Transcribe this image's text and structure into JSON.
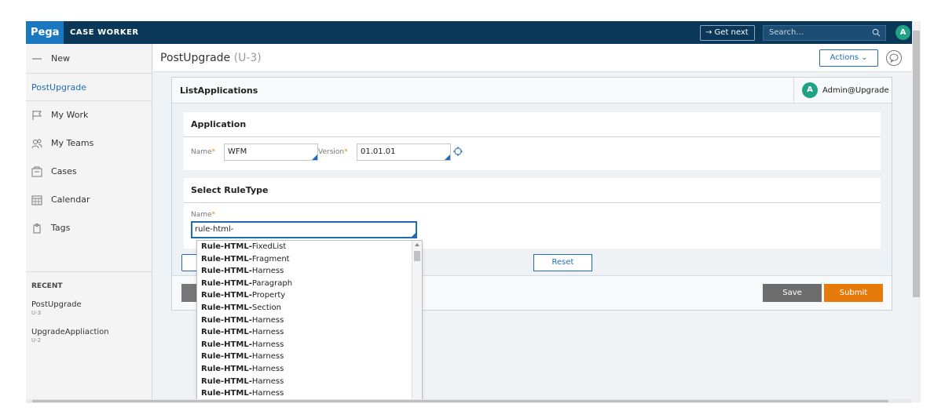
{
  "app": {
    "logo": "Pega",
    "portal_name": "CASE WORKER"
  },
  "topbar": {
    "get_next": "→ Get next",
    "search_placeholder": "Search...",
    "avatar_initial": "A"
  },
  "sidebar": {
    "new_label": "New",
    "current_case": "PostUpgrade",
    "items": [
      {
        "label": "My Work",
        "icon": "flag-icon"
      },
      {
        "label": "My Teams",
        "icon": "team-icon"
      },
      {
        "label": "Cases",
        "icon": "case-icon"
      },
      {
        "label": "Calendar",
        "icon": "calendar-icon"
      },
      {
        "label": "Tags",
        "icon": "tag-icon"
      }
    ],
    "recent_heading": "RECENT",
    "recent": [
      {
        "title": "PostUpgrade",
        "id": "U-3"
      },
      {
        "title": "UpgradeAppliaction",
        "id": "U-2"
      }
    ]
  },
  "case": {
    "title": "PostUpgrade",
    "id": "(U-3)",
    "actions_label": "Actions"
  },
  "panel": {
    "title": "ListApplications",
    "user": {
      "initial": "A",
      "name": "Admin@Upgrade"
    },
    "application": {
      "heading": "Application",
      "name_label": "Name",
      "name_value": "WFM",
      "version_label": "Version",
      "version_value": "01.01.01"
    },
    "ruletype": {
      "heading": "Select RuleType",
      "name_label": "Name",
      "name_value": "rule-html-"
    },
    "reset_label": "Reset",
    "save_label": "Save",
    "submit_label": "Submit",
    "required_mark": "*"
  },
  "dropdown": {
    "items": [
      {
        "match": "Rule-HTML-",
        "rest": "FixedList"
      },
      {
        "match": "Rule-HTML-",
        "rest": "Fragment"
      },
      {
        "match": "Rule-HTML-",
        "rest": "Harness"
      },
      {
        "match": "Rule-HTML-",
        "rest": "Paragraph"
      },
      {
        "match": "Rule-HTML-",
        "rest": "Property"
      },
      {
        "match": "Rule-HTML-",
        "rest": "Section"
      },
      {
        "match": "Rule-HTML-",
        "rest": "Harness"
      },
      {
        "match": "Rule-HTML-",
        "rest": "Harness"
      },
      {
        "match": "Rule-HTML-",
        "rest": "Harness"
      },
      {
        "match": "Rule-HTML-",
        "rest": "Harness"
      },
      {
        "match": "Rule-HTML-",
        "rest": "Harness"
      },
      {
        "match": "Rule-HTML-",
        "rest": "Harness"
      },
      {
        "match": "Rule-HTML-",
        "rest": "Harness"
      }
    ]
  },
  "colors": {
    "topbar": "#0b3759",
    "accent": "#1f6cb5",
    "submit": "#e67a0a",
    "avatar": "#1fa384"
  }
}
